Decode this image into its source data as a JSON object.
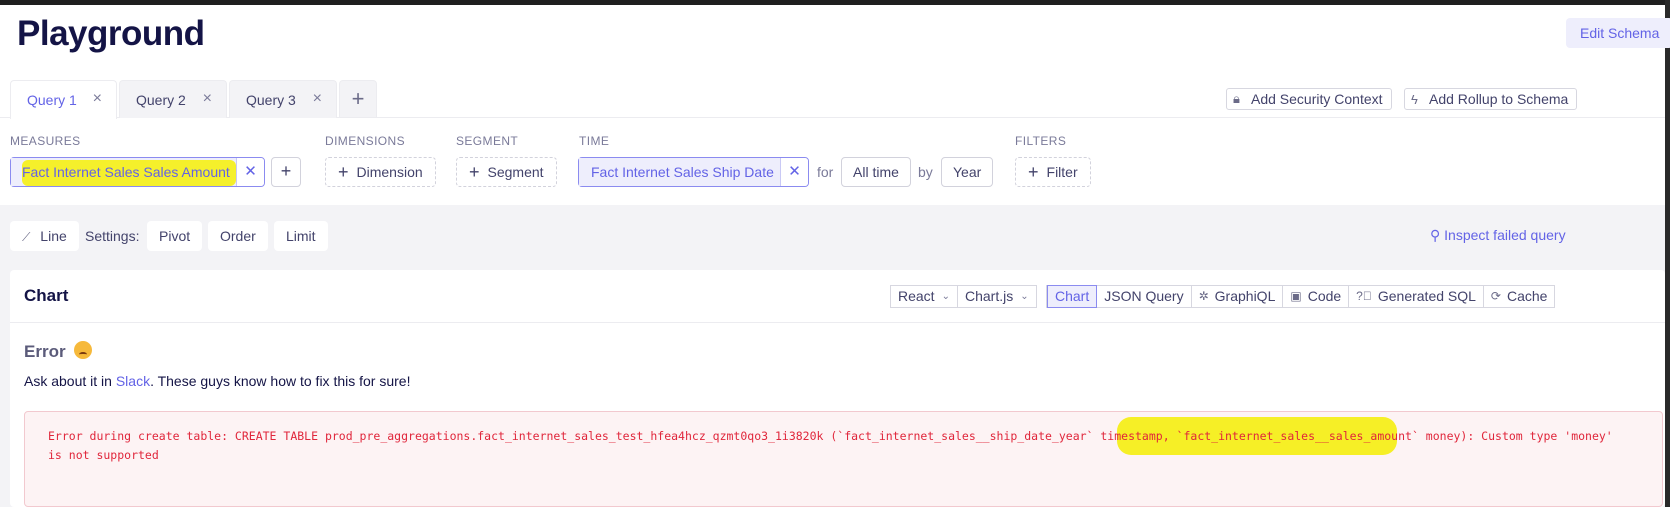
{
  "header": {
    "title": "Playground",
    "edit_schema": "Edit Schema"
  },
  "tabs": [
    {
      "label": "Query 1",
      "active": true
    },
    {
      "label": "Query 2",
      "active": false
    },
    {
      "label": "Query 3",
      "active": false
    }
  ],
  "context_buttons": {
    "security": "Add Security Context",
    "rollup": "Add Rollup to Schema"
  },
  "query_builder": {
    "measures_label": "MEASURES",
    "measure_value": "Fact Internet Sales Sales Amount",
    "dimensions_label": "DIMENSIONS",
    "dimension_button": "Dimension",
    "segment_label": "SEGMENT",
    "segment_button": "Segment",
    "time_label": "TIME",
    "time_value": "Fact Internet Sales Ship Date",
    "for_text": "for",
    "range_value": "All time",
    "by_text": "by",
    "granularity_value": "Year",
    "filters_label": "FILTERS",
    "filter_button": "Filter"
  },
  "toolbar": {
    "chart_type": "Line",
    "settings_label": "Settings:",
    "pivot": "Pivot",
    "order": "Order",
    "limit": "Limit",
    "inspect": "Inspect failed query"
  },
  "chart_card": {
    "title": "Chart",
    "framework": "React",
    "library": "Chart.js",
    "views": [
      "Chart",
      "JSON Query",
      "GraphiQL",
      "Code",
      "Generated SQL",
      "Cache"
    ]
  },
  "error": {
    "title": "Error",
    "message_before": "Ask about it in ",
    "message_link": "Slack",
    "message_after": ". These guys know how to fix this for sure!",
    "code_line1": "Error during create table: CREATE TABLE prod_pre_aggregations.fact_internet_sales_test_hfea4hcz_qzmt0qo3_1i3820k (`fact_internet_sales__ship_date_year` timestamp, `fact_internet_sales__sales_amount` money): Custom type 'money'",
    "code_line2": "is not supported"
  },
  "colors": {
    "accent": "#6363e6",
    "highlight": "#f5ef14",
    "error_text": "#e0263b",
    "error_bg": "#fdf3f4"
  }
}
